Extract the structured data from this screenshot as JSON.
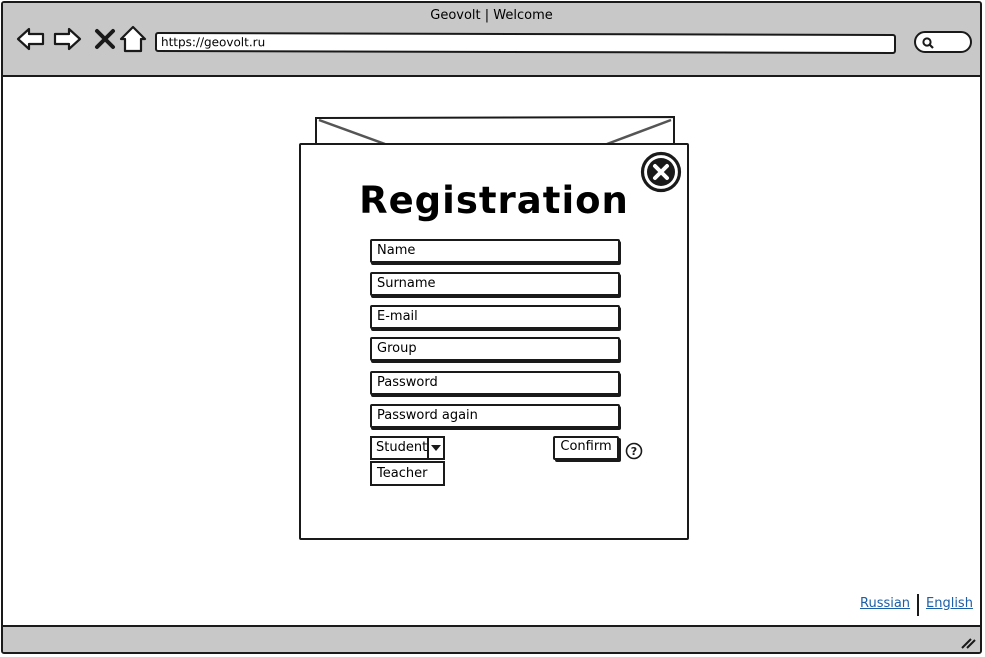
{
  "window": {
    "title": "Geovolt | Welcome"
  },
  "browser": {
    "url": "https://geovolt.ru",
    "nav_icons": [
      "back-arrow-icon",
      "forward-arrow-icon",
      "close-x-icon",
      "home-icon"
    ],
    "search_icon": "search-icon"
  },
  "dialog": {
    "icon": "envelope-icon",
    "title": "Registration",
    "close_icon": "close-circle-icon",
    "fields": [
      {
        "placeholder": "Name"
      },
      {
        "placeholder": "Surname"
      },
      {
        "placeholder": "E-mail"
      },
      {
        "placeholder": "Group"
      },
      {
        "placeholder": "Password"
      },
      {
        "placeholder": "Password again"
      }
    ],
    "role_select": {
      "selected": "Student",
      "options": [
        "Teacher"
      ]
    },
    "confirm_label": "Confirm",
    "help_icon": "help-question-icon"
  },
  "footer": {
    "languages": [
      "Russian",
      "English"
    ],
    "link_color": "#1a5fa8"
  }
}
